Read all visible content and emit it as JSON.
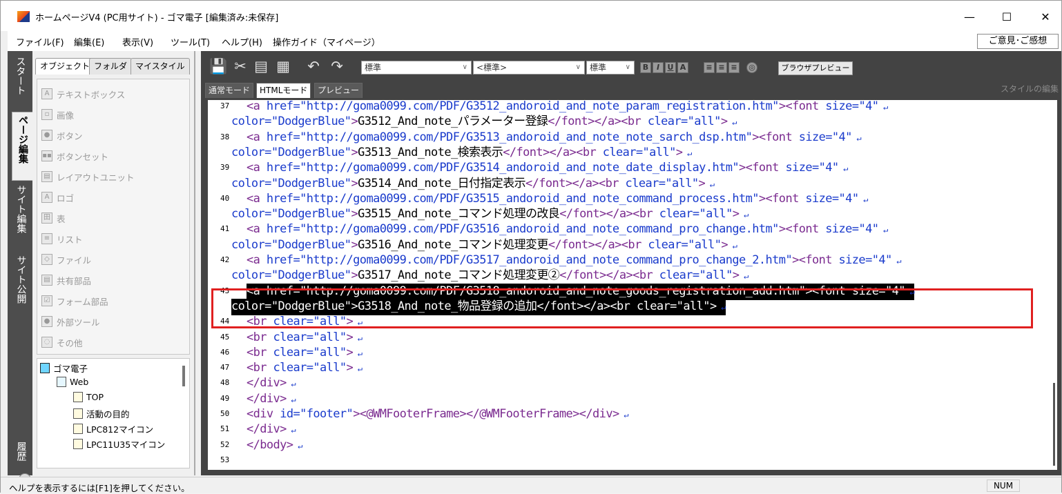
{
  "window": {
    "title": "ホームページV4 (PC用サイト) - ゴマ電子 [編集済み:未保存]",
    "minimize": "—",
    "maximize": "☐",
    "close": "✕"
  },
  "menu": {
    "items": [
      "ファイル(F)",
      "編集(E)",
      "表示(V)",
      "ツール(T)",
      "ヘルプ(H)",
      "操作ガイド（マイページ）"
    ],
    "feedback": "ご意見･ご感想"
  },
  "left_tabs": {
    "start": "スタート",
    "page_edit": "ページ編集",
    "site_edit": "サイト編集",
    "site_publish": "サイト公開",
    "history": "履歴"
  },
  "object_panel": {
    "tabs": [
      "オブジェクト",
      "フォルダ",
      "マイスタイル"
    ],
    "items": [
      {
        "icon": "A",
        "label": "テキストボックス"
      },
      {
        "icon": "▫",
        "label": "画像"
      },
      {
        "icon": "●",
        "label": "ボタン"
      },
      {
        "icon": "▪▪",
        "label": "ボタンセット"
      },
      {
        "icon": "▤",
        "label": "レイアウトユニット"
      },
      {
        "icon": "A",
        "label": "ロゴ"
      },
      {
        "icon": "田",
        "label": "表"
      },
      {
        "icon": "≡",
        "label": "リスト"
      },
      {
        "icon": "◇",
        "label": "ファイル"
      },
      {
        "icon": "▤",
        "label": "共有部品"
      },
      {
        "icon": "☑",
        "label": "フォーム部品"
      },
      {
        "icon": "●",
        "label": "外部ツール"
      },
      {
        "icon": "◌",
        "label": "その他"
      }
    ]
  },
  "tree": {
    "root": "ゴマ電子",
    "web": "Web",
    "pages": [
      "TOP",
      "活動の目的",
      "LPC812マイコン",
      "LPC11U35マイコン"
    ]
  },
  "toolbar": {
    "style_select": "標準",
    "tag_select": "<標準>",
    "size_select": "標準",
    "bold": "B",
    "italic": "I",
    "underline": "U",
    "font_color": "A",
    "preview_button": "ブラウザプレビュー"
  },
  "mode_tabs": [
    "通常モード",
    "HTMLモード",
    "プレビュー"
  ],
  "style_edit": "スタイルの編集",
  "code": {
    "lines": [
      {
        "n": "37",
        "segments": [
          [
            "tag",
            "<a "
          ],
          [
            "at",
            "href="
          ],
          [
            "val",
            "\"http://goma0099.com/PDF/G3512_andoroid_and_note_param_registration.htm\""
          ],
          [
            "tag",
            "><font "
          ],
          [
            "at",
            "size="
          ],
          [
            "val",
            "\"4\""
          ]
        ]
      },
      {
        "n": "",
        "segments": [
          [
            "at",
            "color="
          ],
          [
            "val",
            "\"DodgerBlue\""
          ],
          [
            "tag",
            ">"
          ],
          [
            "txt",
            "G3512_And_note_パラメーター登録"
          ],
          [
            "tag",
            "</font></a><br "
          ],
          [
            "at",
            "clear="
          ],
          [
            "val",
            "\"all\""
          ],
          [
            "tag",
            ">"
          ]
        ]
      },
      {
        "n": "38",
        "segments": [
          [
            "tag",
            "<a "
          ],
          [
            "at",
            "href="
          ],
          [
            "val",
            "\"http://goma0099.com/PDF/G3513_andoroid_and_note_note_sarch_dsp.htm\""
          ],
          [
            "tag",
            "><font "
          ],
          [
            "at",
            "size="
          ],
          [
            "val",
            "\"4\""
          ]
        ]
      },
      {
        "n": "",
        "segments": [
          [
            "at",
            "color="
          ],
          [
            "val",
            "\"DodgerBlue\""
          ],
          [
            "tag",
            ">"
          ],
          [
            "txt",
            "G3513_And_note_検索表示"
          ],
          [
            "tag",
            "</font></a><br "
          ],
          [
            "at",
            "clear="
          ],
          [
            "val",
            "\"all\""
          ],
          [
            "tag",
            ">"
          ]
        ]
      },
      {
        "n": "39",
        "segments": [
          [
            "tag",
            "<a "
          ],
          [
            "at",
            "href="
          ],
          [
            "val",
            "\"http://goma0099.com/PDF/G3514_andoroid_and_note_date_display.htm\""
          ],
          [
            "tag",
            "><font "
          ],
          [
            "at",
            "size="
          ],
          [
            "val",
            "\"4\""
          ]
        ]
      },
      {
        "n": "",
        "segments": [
          [
            "at",
            "color="
          ],
          [
            "val",
            "\"DodgerBlue\""
          ],
          [
            "tag",
            ">"
          ],
          [
            "txt",
            "G3514_And_note_日付指定表示"
          ],
          [
            "tag",
            "</font></a><br "
          ],
          [
            "at",
            "clear="
          ],
          [
            "val",
            "\"all\""
          ],
          [
            "tag",
            ">"
          ]
        ]
      },
      {
        "n": "40",
        "segments": [
          [
            "tag",
            "<a "
          ],
          [
            "at",
            "href="
          ],
          [
            "val",
            "\"http://goma0099.com/PDF/G3515_andoroid_and_note_command_process.htm\""
          ],
          [
            "tag",
            "><font "
          ],
          [
            "at",
            "size="
          ],
          [
            "val",
            "\"4\""
          ]
        ]
      },
      {
        "n": "",
        "segments": [
          [
            "at",
            "color="
          ],
          [
            "val",
            "\"DodgerBlue\""
          ],
          [
            "tag",
            ">"
          ],
          [
            "txt",
            "G3515_And_note_コマンド処理の改良"
          ],
          [
            "tag",
            "</font></a><br "
          ],
          [
            "at",
            "clear="
          ],
          [
            "val",
            "\"all\""
          ],
          [
            "tag",
            ">"
          ]
        ]
      },
      {
        "n": "41",
        "segments": [
          [
            "tag",
            "<a "
          ],
          [
            "at",
            "href="
          ],
          [
            "val",
            "\"http://goma0099.com/PDF/G3516_andoroid_and_note_command_pro_change.htm\""
          ],
          [
            "tag",
            "><font "
          ],
          [
            "at",
            "size="
          ],
          [
            "val",
            "\"4\""
          ]
        ]
      },
      {
        "n": "",
        "segments": [
          [
            "at",
            "color="
          ],
          [
            "val",
            "\"DodgerBlue\""
          ],
          [
            "tag",
            ">"
          ],
          [
            "txt",
            "G3516_And_note_コマンド処理変更"
          ],
          [
            "tag",
            "</font></a><br "
          ],
          [
            "at",
            "clear="
          ],
          [
            "val",
            "\"all\""
          ],
          [
            "tag",
            ">"
          ]
        ]
      },
      {
        "n": "42",
        "segments": [
          [
            "tag",
            "<a "
          ],
          [
            "at",
            "href="
          ],
          [
            "val",
            "\"http://goma0099.com/PDF/G3517_andoroid_and_note_command_pro_change_2.htm\""
          ],
          [
            "tag",
            "><font "
          ],
          [
            "at",
            "size="
          ],
          [
            "val",
            "\"4\""
          ]
        ]
      },
      {
        "n": "",
        "segments": [
          [
            "at",
            "color="
          ],
          [
            "val",
            "\"DodgerBlue\""
          ],
          [
            "tag",
            ">"
          ],
          [
            "txt",
            "G3517_And_note_コマンド処理変更②"
          ],
          [
            "tag",
            "</font></a><br "
          ],
          [
            "at",
            "clear="
          ],
          [
            "val",
            "\"all\""
          ],
          [
            "tag",
            ">"
          ]
        ]
      },
      {
        "n": "43",
        "sel": true,
        "segments": [
          [
            "tag",
            "<a "
          ],
          [
            "at",
            "href="
          ],
          [
            "val",
            "\"http://goma0099.com/PDF/G3518_andoroid_and_note_goods_registration_add.htm\""
          ],
          [
            "tag",
            "><font "
          ],
          [
            "at",
            "size="
          ],
          [
            "val",
            "\"4\""
          ]
        ]
      },
      {
        "n": "",
        "sel": true,
        "segments": [
          [
            "at",
            "color="
          ],
          [
            "val",
            "\"DodgerBlue\""
          ],
          [
            "tag",
            ">"
          ],
          [
            "txt",
            "G3518_And_note_物品登録の追加"
          ],
          [
            "tag",
            "</font></a><br "
          ],
          [
            "at",
            "clear="
          ],
          [
            "val",
            "\"all\""
          ],
          [
            "tag",
            ">"
          ]
        ]
      },
      {
        "n": "44",
        "segments": [
          [
            "tag",
            "<br "
          ],
          [
            "at",
            "clear="
          ],
          [
            "val",
            "\"all\""
          ],
          [
            "tag",
            ">"
          ]
        ]
      },
      {
        "n": "45",
        "segments": [
          [
            "tag",
            "<br "
          ],
          [
            "at",
            "clear="
          ],
          [
            "val",
            "\"all\""
          ],
          [
            "tag",
            ">"
          ]
        ]
      },
      {
        "n": "46",
        "segments": [
          [
            "tag",
            "<br "
          ],
          [
            "at",
            "clear="
          ],
          [
            "val",
            "\"all\""
          ],
          [
            "tag",
            ">"
          ]
        ]
      },
      {
        "n": "47",
        "segments": [
          [
            "tag",
            "<br "
          ],
          [
            "at",
            "clear="
          ],
          [
            "val",
            "\"all\""
          ],
          [
            "tag",
            ">"
          ]
        ]
      },
      {
        "n": "48",
        "segments": [
          [
            "tag",
            "</div>"
          ]
        ]
      },
      {
        "n": "49",
        "segments": [
          [
            "tag",
            "</div>"
          ]
        ]
      },
      {
        "n": "50",
        "segments": [
          [
            "tag",
            "<div "
          ],
          [
            "at",
            "id="
          ],
          [
            "val",
            "\"footer\""
          ],
          [
            "tag",
            "><@WMFooterFrame></@WMFooterFrame></div>"
          ]
        ]
      },
      {
        "n": "51",
        "segments": [
          [
            "tag",
            "</div>"
          ]
        ]
      },
      {
        "n": "52",
        "segments": [
          [
            "tag",
            "</body>"
          ]
        ]
      },
      {
        "n": "53",
        "segments": []
      }
    ]
  },
  "status": {
    "help": "ヘルプを表示するには[F1]を押してください。",
    "num": "NUM"
  }
}
